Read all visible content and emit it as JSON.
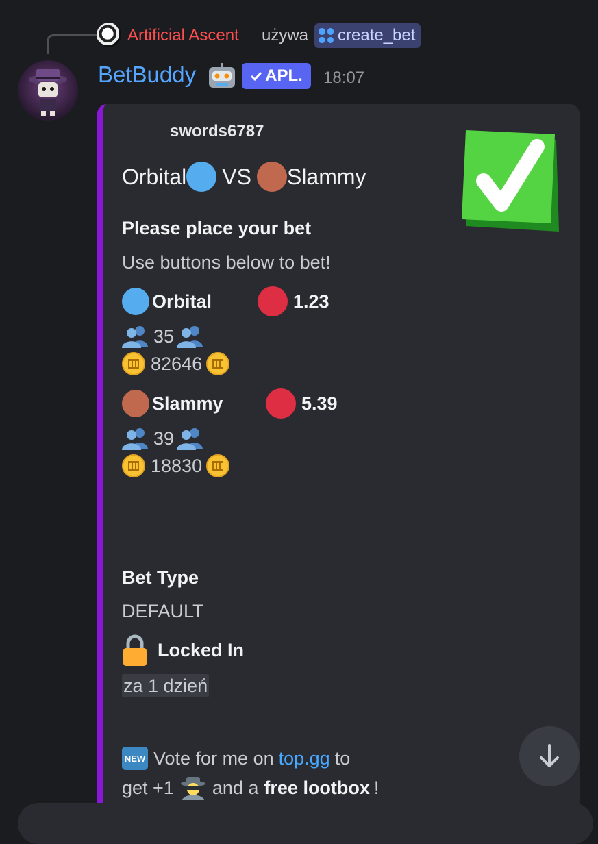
{
  "reply": {
    "user": "Artificial Ascent",
    "verb": "używa",
    "command": "create_bet"
  },
  "message": {
    "author": "BetBuddy",
    "author_icon": "robot-icon",
    "badge": "APL.",
    "time": "18:07"
  },
  "embed": {
    "accent_color": "#8a17d6",
    "author": "swords6787",
    "title_left": "Orbital",
    "title_vs": "VS",
    "title_right": "Slammy",
    "prompt_heading": "Please place your bet",
    "prompt_text": "Use buttons below to bet!",
    "teams": [
      {
        "name": "Orbital",
        "color": "#55acee",
        "odds": "1.23",
        "players": "35",
        "coins": "82646"
      },
      {
        "name": "Slammy",
        "color": "#c1694f",
        "odds": "5.39",
        "players": "39",
        "coins": "18830"
      }
    ],
    "bet_type_label": "Bet Type",
    "bet_type_value": "DEFAULT",
    "locked_label": "Locked In",
    "locked_value": "za 1 dzień",
    "vote": {
      "badge": "NEW",
      "text_1": "Vote for me on",
      "link": "top.gg",
      "text_2": "to",
      "text_3": "get +1",
      "text_4": "and a",
      "bold": "free lootbox",
      "text_5": "!"
    }
  }
}
